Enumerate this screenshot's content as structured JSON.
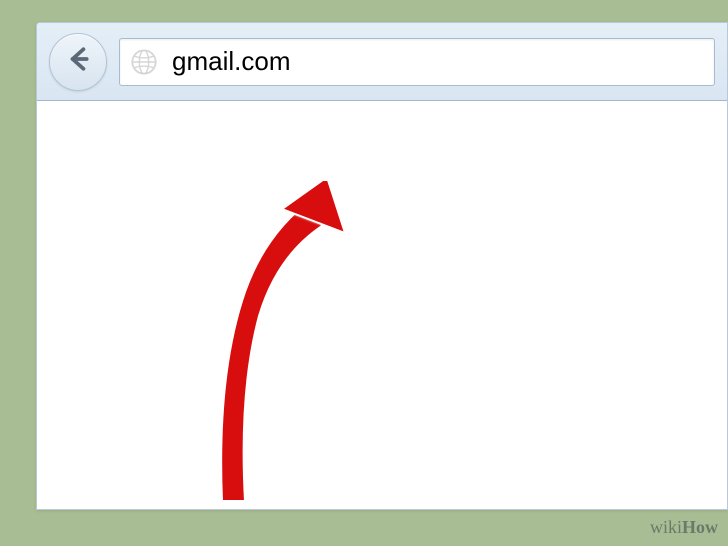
{
  "browser": {
    "url": "gmail.com",
    "back_button_label": "Back"
  },
  "icons": {
    "globe": "globe-icon",
    "back_arrow": "←"
  },
  "watermark": {
    "part1": "wiki",
    "part2": "How"
  }
}
